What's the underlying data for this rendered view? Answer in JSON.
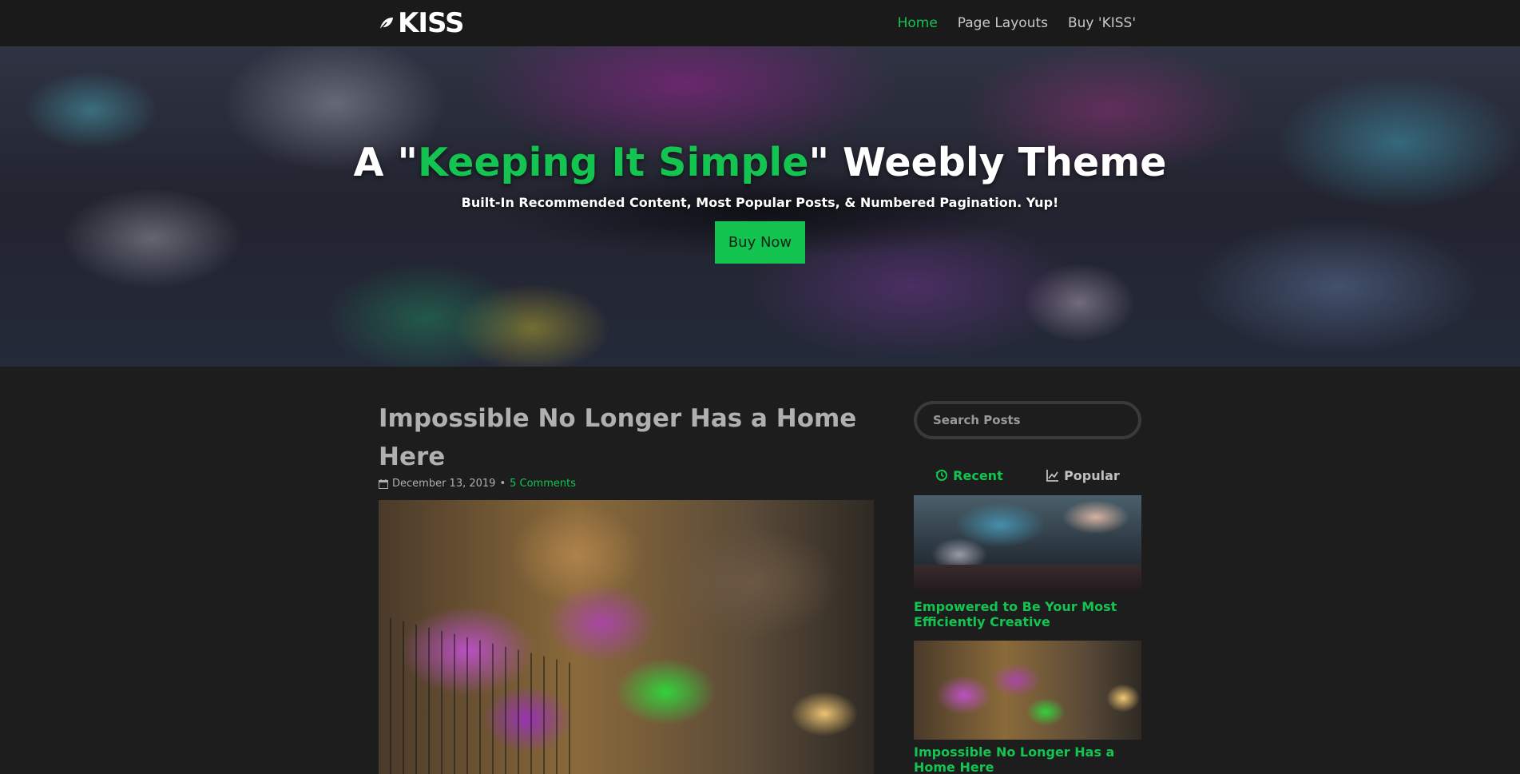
{
  "header": {
    "logo_text": "KISS",
    "nav": [
      {
        "label": "Home",
        "active": true
      },
      {
        "label": "Page Layouts",
        "active": false
      },
      {
        "label": "Buy 'KISS'",
        "active": false
      }
    ]
  },
  "hero": {
    "title_before": "A \"",
    "title_accent": "Keeping It Simple",
    "title_after": "\" Weebly Theme",
    "subtitle": "Built-In Recommended Content, Most Popular Posts, & Numbered Pagination. Yup!",
    "button_label": "Buy Now"
  },
  "post": {
    "title": "Impossible No Longer Has a Home Here",
    "date": "December 13, 2019",
    "separator": "•",
    "comments": "5 Comments"
  },
  "sidebar": {
    "search_placeholder": "Search Posts",
    "tabs": [
      {
        "label": "Recent",
        "icon": "history-icon",
        "active": true
      },
      {
        "label": "Popular",
        "icon": "line-chart-icon",
        "active": false
      }
    ],
    "posts": [
      {
        "title": "Empowered to Be Your Most Efficiently Creative"
      },
      {
        "title": "Impossible No Longer Has a Home Here"
      }
    ]
  },
  "colors": {
    "accent": "#13c550",
    "background": "#1d1d1d",
    "topbar": "#1a1a1a"
  }
}
